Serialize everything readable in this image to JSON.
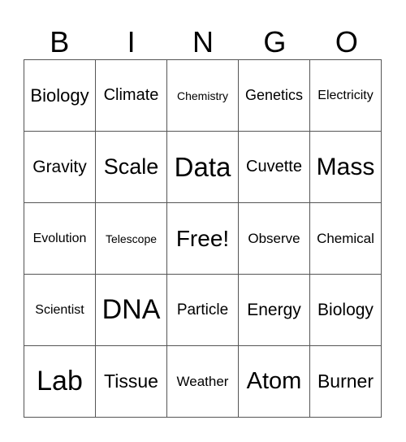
{
  "header": [
    "B",
    "I",
    "N",
    "G",
    "O"
  ],
  "rows": [
    [
      "Biology",
      "Climate",
      "Chemistry",
      "Genetics",
      "Electricity"
    ],
    [
      "Gravity",
      "Scale",
      "Data",
      "Cuvette",
      "Mass"
    ],
    [
      "Evolution",
      "Telescope",
      "Free!",
      "Observe",
      "Chemical"
    ],
    [
      "Scientist",
      "DNA",
      "Particle",
      "Energy",
      "Biology"
    ],
    [
      "Lab",
      "Tissue",
      "Weather",
      "Atom",
      "Burner"
    ]
  ]
}
